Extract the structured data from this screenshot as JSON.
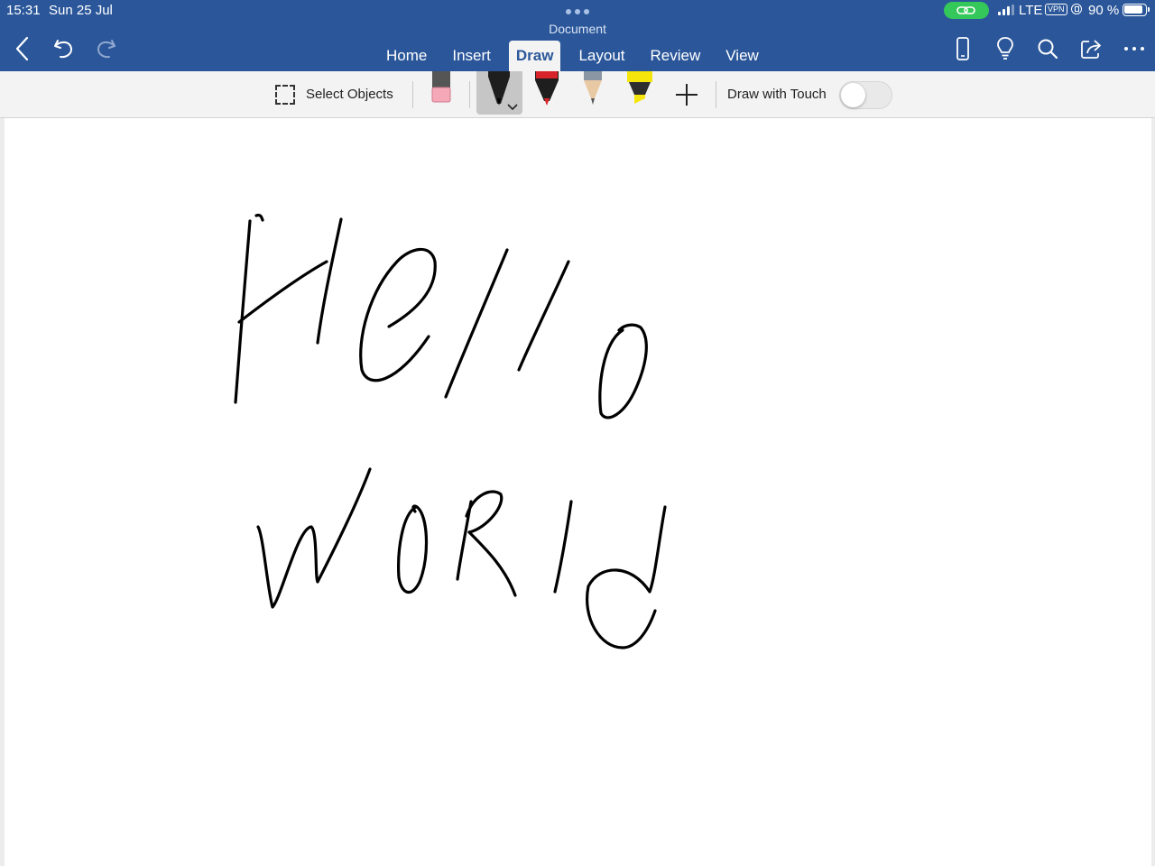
{
  "status": {
    "time": "15:31",
    "date": "Sun 25 Jul",
    "network": "LTE",
    "vpn": "VPN",
    "battery": "90 %"
  },
  "document": {
    "title": "Document"
  },
  "toolbar": {
    "back_icon": "chevron-left-icon",
    "undo_icon": "undo-icon",
    "redo_icon": "redo-icon"
  },
  "tabs": [
    {
      "label": "Home"
    },
    {
      "label": "Insert"
    },
    {
      "label": "Draw",
      "active": true
    },
    {
      "label": "Layout"
    },
    {
      "label": "Review"
    },
    {
      "label": "View"
    }
  ],
  "right_icons": [
    "phone-view-icon",
    "lightbulb-icon",
    "search-icon",
    "share-icon",
    "more-icon"
  ],
  "ribbon": {
    "select_objects": "Select Objects",
    "draw_with_touch": "Draw with Touch",
    "draw_with_touch_on": false,
    "tools": [
      "eraser",
      "pen-black",
      "pen-red",
      "pencil-gray",
      "highlighter-yellow"
    ]
  },
  "canvas": {
    "handwriting_lines": [
      "Hello",
      "world"
    ]
  },
  "colors": {
    "header": "#2b579a",
    "ribbon": "#f3f3f3",
    "link_pill": "#34c759",
    "red_pen": "#d8232a",
    "highlighter": "#f5e50a"
  }
}
